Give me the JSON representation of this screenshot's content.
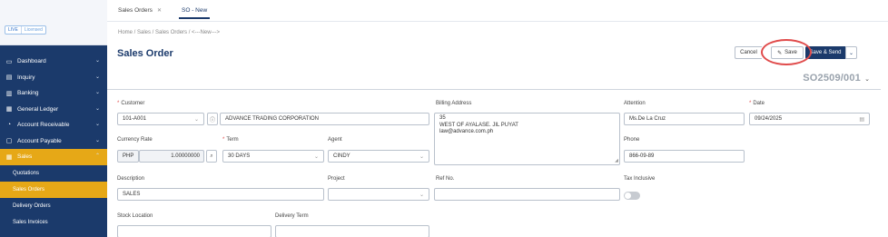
{
  "mode": {
    "live": "LIVE",
    "licensed": "Licensed"
  },
  "tabs": [
    {
      "label": "Sales Orders",
      "close": "✕"
    },
    {
      "label": "SO - New"
    }
  ],
  "sidebar": {
    "items": [
      {
        "label": "Dashboard",
        "icon": "dashboard-icon",
        "glyph": "▭"
      },
      {
        "label": "Inquiry",
        "icon": "inquiry-icon",
        "glyph": "▤"
      },
      {
        "label": "Banking",
        "icon": "banking-icon",
        "glyph": "▥"
      },
      {
        "label": "General Ledger",
        "icon": "ledger-icon",
        "glyph": "▦"
      },
      {
        "label": "Account Receivable",
        "icon": "receivable-icon",
        "glyph": "◔"
      },
      {
        "label": "Account Payable",
        "icon": "payable-icon",
        "glyph": "▢"
      },
      {
        "label": "Sales",
        "icon": "sales-icon",
        "glyph": "▦"
      }
    ],
    "sales_sub": [
      "Quotations",
      "Sales Orders",
      "Delivery Orders",
      "Sales Invoices"
    ],
    "chevron": "⌄",
    "active_color": "#e6a817",
    "bg_color": "#1b3a6b"
  },
  "breadcrumb": "Home  /  Sales  /  Sales Orders  /  <---New--->",
  "page": {
    "title": "Sales Order",
    "doc_no": "SO2509/001",
    "doc_chev": "⌄"
  },
  "buttons": {
    "cancel": "Cancel",
    "save": "Save",
    "save_send": "Save & Send",
    "caret": "⌄",
    "pen": "✎"
  },
  "form": {
    "customer": {
      "label": "Customer",
      "code": "101-A001",
      "name": "ADVANCE TRADING CORPORATION",
      "info": "ⓘ"
    },
    "billing": {
      "label": "Billing Address",
      "lines": [
        "35",
        "WEST OF AYALASE. JIL PUYAT",
        "law@advance.com.ph"
      ]
    },
    "attention": {
      "label": "Attention",
      "value": "Ms.De La Cruz"
    },
    "date": {
      "label": "Date",
      "value": "09/24/2025"
    },
    "currency": {
      "label": "Currency Rate",
      "code": "PHP",
      "rate": "1.00000000"
    },
    "term": {
      "label": "Term",
      "value": "30 DAYS"
    },
    "agent": {
      "label": "Agent",
      "value": "CINDY"
    },
    "phone": {
      "label": "Phone",
      "value": "866-09-89"
    },
    "description": {
      "label": "Description",
      "value": "SALES"
    },
    "project": {
      "label": "Project",
      "value": ""
    },
    "ref_no": {
      "label": "Ref No.",
      "value": ""
    },
    "tax_inclusive": {
      "label": "Tax Inclusive",
      "on": false
    },
    "stock_location": {
      "label": "Stock Location",
      "value": ""
    },
    "delivery_term": {
      "label": "Delivery Term",
      "value": ""
    }
  }
}
